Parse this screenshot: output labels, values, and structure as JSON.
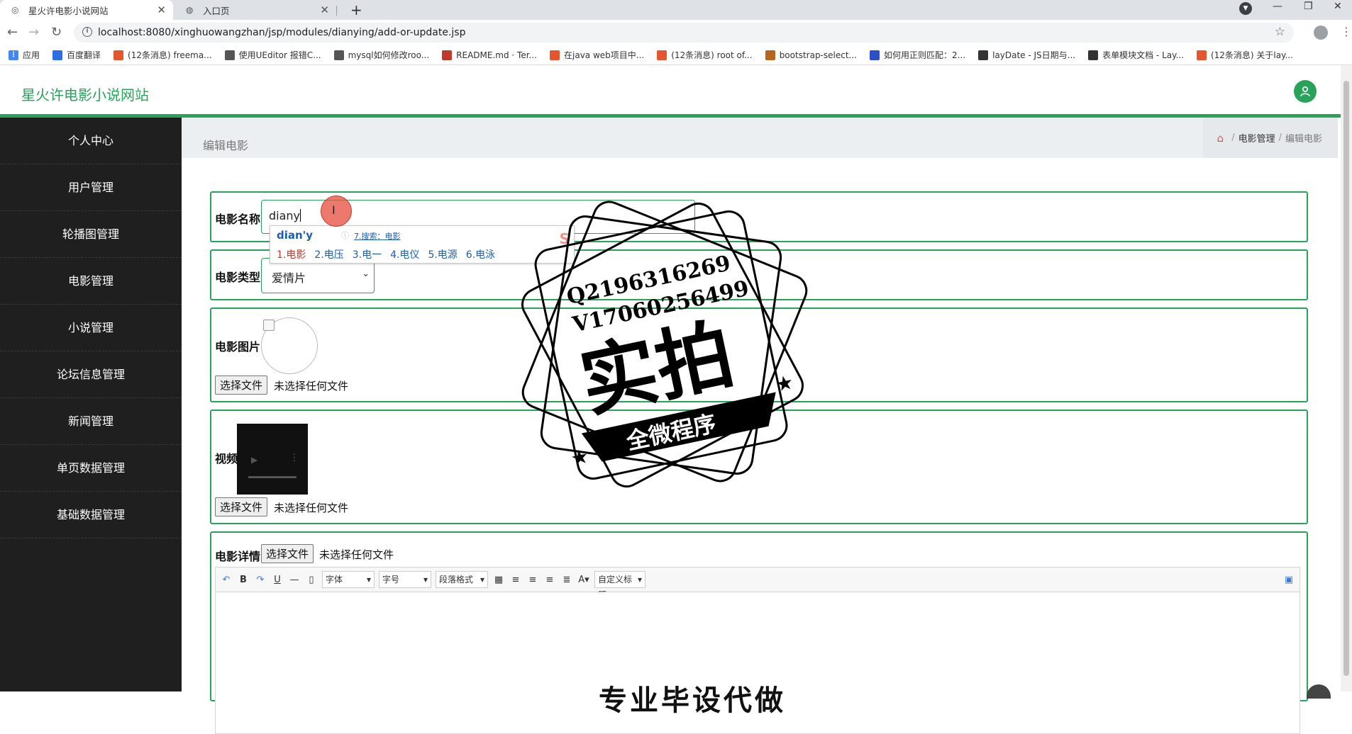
{
  "browser": {
    "tabs": [
      {
        "title": "星火许电影小说网站",
        "active": true
      },
      {
        "title": "入口页",
        "active": false
      }
    ],
    "url": "localhost:8080/xinghuowangzhan/jsp/modules/dianying/add-or-update.jsp",
    "bookmarks": [
      {
        "label": "应用",
        "color": "#4285f4"
      },
      {
        "label": "百度翻译",
        "color": "#2b6de5"
      },
      {
        "label": "(12条消息) freema...",
        "color": "#e4572e"
      },
      {
        "label": "使用UEditor 报错C...",
        "color": "#555555"
      },
      {
        "label": "mysql如何修改roo...",
        "color": "#555555"
      },
      {
        "label": "README.md · Ter...",
        "color": "#c0392b"
      },
      {
        "label": "在java web项目中...",
        "color": "#e4572e"
      },
      {
        "label": "(12条消息) root of...",
        "color": "#e4572e"
      },
      {
        "label": "bootstrap-select...",
        "color": "#b5651d"
      },
      {
        "label": "如何用正则匹配：2...",
        "color": "#2b50c8"
      },
      {
        "label": "layDate - JS日期与...",
        "color": "#333333"
      },
      {
        "label": "表单模块文档 - Lay...",
        "color": "#333333"
      },
      {
        "label": "(12条消息) 关于lay...",
        "color": "#e4572e"
      }
    ]
  },
  "site": {
    "title": "星火许电影小说网站",
    "accent": "#2aa35a"
  },
  "sidebar": {
    "items": [
      {
        "label": "个人中心"
      },
      {
        "label": "用户管理"
      },
      {
        "label": "轮播图管理"
      },
      {
        "label": "电影管理"
      },
      {
        "label": "小说管理"
      },
      {
        "label": "论坛信息管理"
      },
      {
        "label": "新闻管理"
      },
      {
        "label": "单页数据管理"
      },
      {
        "label": "基础数据管理"
      }
    ]
  },
  "page": {
    "heading": "编辑电影",
    "breadcrumb": {
      "parent": "电影管理",
      "current": "编辑电影",
      "sep": "/"
    }
  },
  "form": {
    "name_label": "电影名称",
    "name_value": "diany",
    "type_label": "电影类型",
    "type_value": "爱情片",
    "image_label": "电影图片",
    "video_label": "视频",
    "detail_label": "电影详情",
    "file_button": "选择文件",
    "file_none": "未选择任何文件"
  },
  "editor": {
    "font_family": "字体",
    "font_size": "字号",
    "paragraph": "段落格式",
    "custom_title": "自定义标题",
    "content_preview": "专业毕设代做"
  },
  "ime": {
    "composition": "dian'y",
    "tip": "7.搜索：电影",
    "candidates": [
      "1.电影",
      "2.电压",
      "3.电一",
      "4.电仪",
      "5.电源",
      "6.电泳"
    ]
  },
  "watermark": {
    "line1": "Q2196316269",
    "line2": "V17060256499",
    "main": "实拍",
    "banner": "全微程序"
  }
}
